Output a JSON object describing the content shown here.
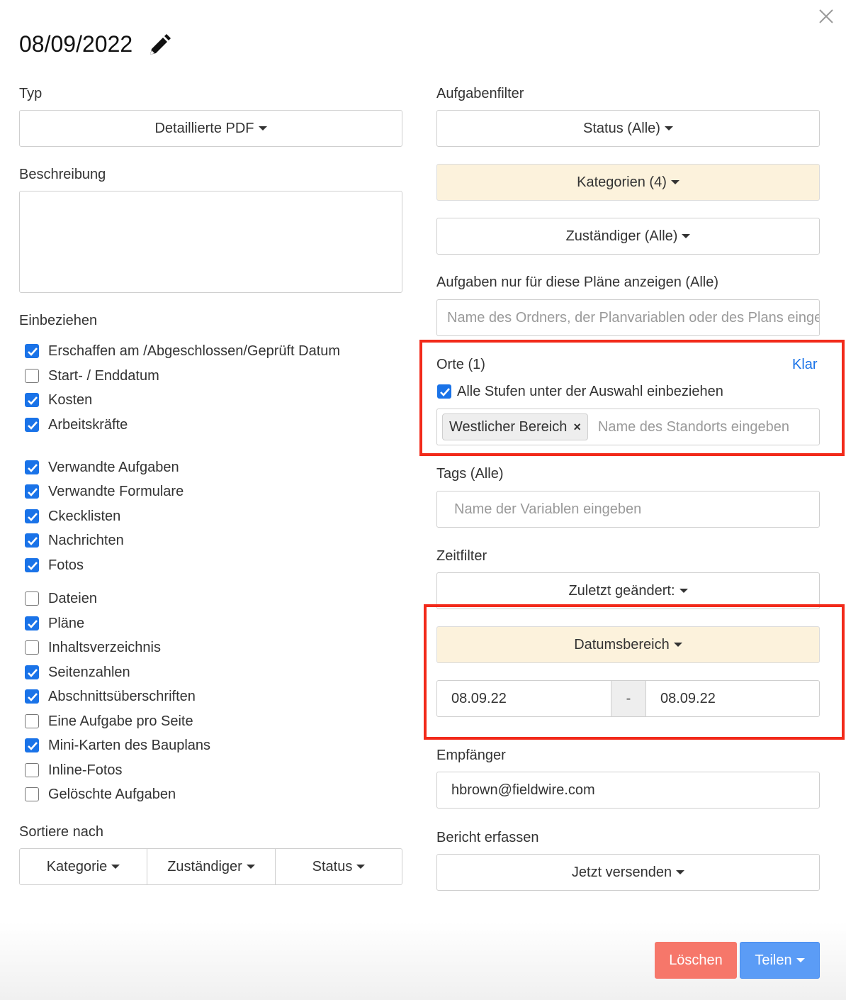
{
  "header": {
    "title": "08/09/2022"
  },
  "left": {
    "type_label": "Typ",
    "type_value": "Detaillierte PDF",
    "description_label": "Beschreibung",
    "include_label": "Einbeziehen",
    "include_items": [
      {
        "label": "Erschaffen am /Abgeschlossen/Geprüft Datum",
        "checked": true
      },
      {
        "label": "Start- / Enddatum",
        "checked": false
      },
      {
        "label": "Kosten",
        "checked": true
      },
      {
        "label": "Arbeitskräfte",
        "checked": true
      },
      {
        "label": "Verwandte Aufgaben",
        "checked": true
      },
      {
        "label": "Verwandte Formulare",
        "checked": true
      },
      {
        "label": "Ckecklisten",
        "checked": true
      },
      {
        "label": "Nachrichten",
        "checked": true
      },
      {
        "label": "Fotos",
        "checked": true
      },
      {
        "label": "Dateien",
        "checked": false
      },
      {
        "label": "Pläne",
        "checked": true
      },
      {
        "label": "Inhaltsverzeichnis",
        "checked": false
      },
      {
        "label": "Seitenzahlen",
        "checked": true
      },
      {
        "label": "Abschnittsüberschriften",
        "checked": true
      },
      {
        "label": "Eine Aufgabe pro Seite",
        "checked": false
      },
      {
        "label": "Mini-Karten des Bauplans",
        "checked": true
      },
      {
        "label": "Inline-Fotos",
        "checked": false
      },
      {
        "label": "Gelöschte Aufgaben",
        "checked": false
      }
    ],
    "sort_label": "Sortiere nach",
    "sort_buttons": [
      "Kategorie",
      "Zuständiger",
      "Status"
    ]
  },
  "right": {
    "filter_label": "Aufgabenfilter",
    "status_btn": "Status (Alle)",
    "categories_btn": "Kategorien (4)",
    "assignee_btn": "Zuständiger (Alle)",
    "plans_label": "Aufgaben nur für diese Pläne anzeigen (Alle)",
    "plans_placeholder": "Name des Ordners, der Planvariablen oder des Plans eingeben",
    "locations_label": "Orte (1)",
    "clear_link": "Klar",
    "include_sublevels": "Alle Stufen unter der Auswahl einbeziehen",
    "location_tag": "Westlicher Bereich",
    "location_placeholder": "Name des Standorts eingeben",
    "tags_label": "Tags (Alle)",
    "tags_placeholder": "Name der Variablen eingeben",
    "time_label": "Zeitfilter",
    "last_changed_btn": "Zuletzt geändert:",
    "date_range_btn": "Datumsbereich",
    "date_from": "08.09.22",
    "date_sep": "-",
    "date_to": "08.09.22",
    "recipient_label": "Empfänger",
    "recipient_value": "hbrown@fieldwire.com",
    "report_label": "Bericht erfassen",
    "send_btn": "Jetzt versenden"
  },
  "footer": {
    "delete_btn": "Löschen",
    "share_btn": "Teilen"
  },
  "colors": {
    "accent": "#1a73e8",
    "highlight": "#fcf2dc",
    "danger": "#f6776a",
    "primary": "#5b9cf6",
    "annotation": "#f22a1a"
  }
}
